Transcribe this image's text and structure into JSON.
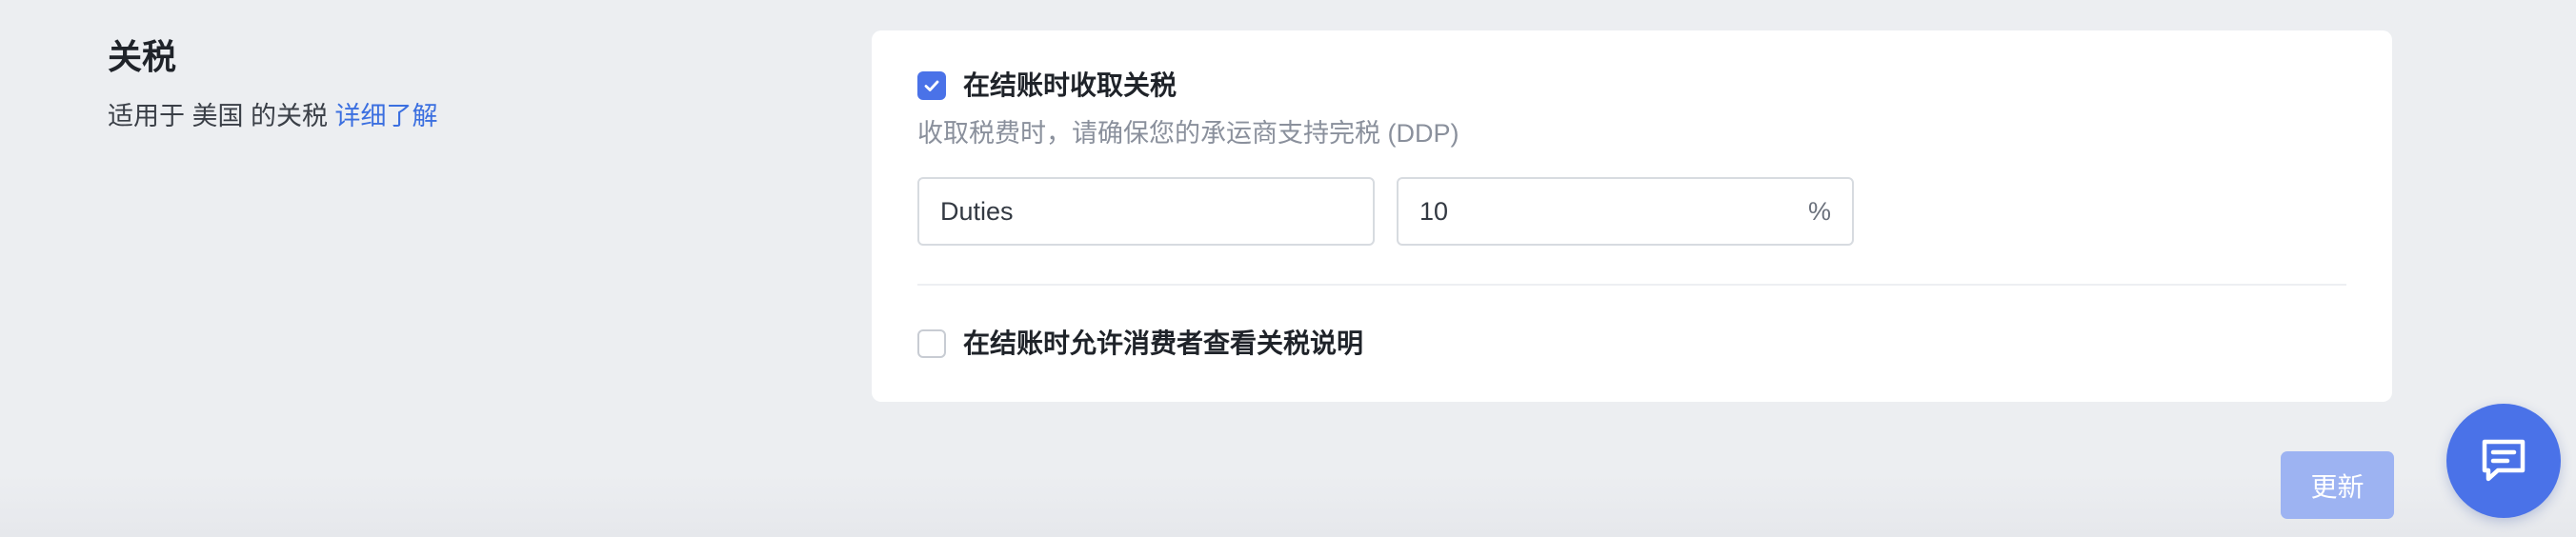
{
  "section": {
    "title": "关税",
    "description_prefix": "适用于 美国 的关税",
    "learn_more": "详细了解"
  },
  "collect_duties": {
    "checked": true,
    "label": "在结账时收取关税",
    "hint": "收取税费时，请确保您的承运商支持完税 (DDP)"
  },
  "duty_name_input": {
    "value": "Duties"
  },
  "duty_rate_input": {
    "value": "10",
    "suffix": "%"
  },
  "show_duties_description": {
    "checked": false,
    "label": "在结账时允许消费者查看关税说明"
  },
  "update_button": {
    "label": "更新"
  },
  "icons": {
    "checkbox_check": "check-icon",
    "chat": "chat-icon"
  },
  "colors": {
    "accent": "#4a72e8",
    "link": "#3b6fe0",
    "disabled_button": "#9db3f2"
  }
}
